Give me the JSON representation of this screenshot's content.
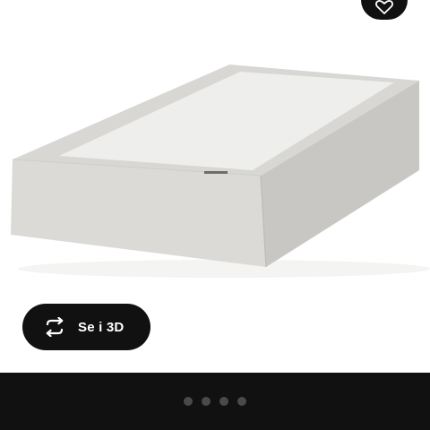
{
  "favorite": {
    "icon": "heart-icon"
  },
  "view3d": {
    "icon": "rotate-360-icon",
    "label": "Se i 3D"
  },
  "carousel": {
    "slide_count": 4
  },
  "colors": {
    "button_bg": "#111111",
    "bottom_bar": "#111111",
    "dot_inactive": "#4a4a4a",
    "bed_fabric": "#dcdad7",
    "bed_top": "#ededeb"
  }
}
